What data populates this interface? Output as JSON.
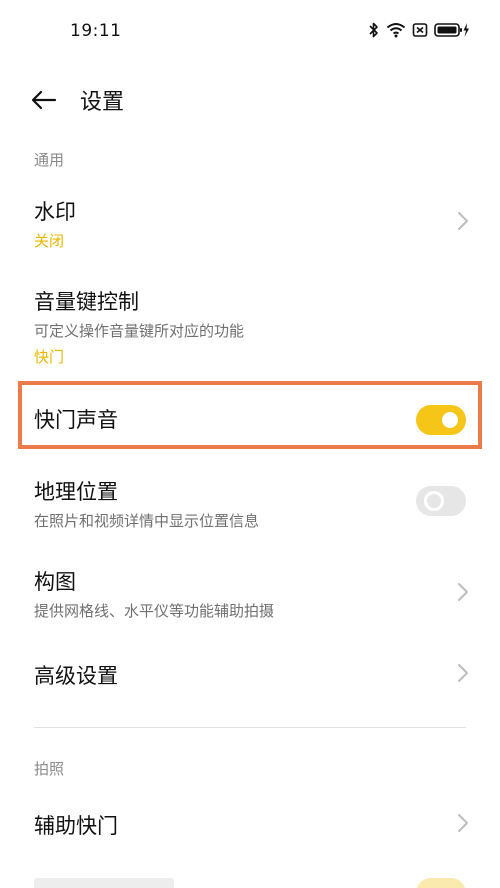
{
  "status_bar": {
    "time": "19:11",
    "icons": [
      "bluetooth-icon",
      "wifi-icon",
      "sim-off-icon",
      "battery-charging-icon"
    ]
  },
  "header": {
    "back_icon": "back-arrow-icon",
    "title": "设置"
  },
  "sections": {
    "general": "通用",
    "photo": "拍照"
  },
  "rows": {
    "watermark": {
      "title": "水印",
      "value": "关闭"
    },
    "volume_key": {
      "title": "音量键控制",
      "desc": "可定义操作音量键所对应的功能",
      "value": "快门"
    },
    "shutter_sound": {
      "title": "快门声音",
      "toggle": "on"
    },
    "location": {
      "title": "地理位置",
      "desc": "在照片和视频详情中显示位置信息",
      "toggle": "off"
    },
    "composition": {
      "title": "构图",
      "desc": "提供网格线、水平仪等功能辅助拍摄"
    },
    "advanced": {
      "title": "高级设置"
    },
    "assist_shutter": {
      "title": "辅助快门"
    }
  },
  "colors": {
    "accent": "#f5c518",
    "value_text": "#e8b700",
    "highlight": "#ec7a4b"
  }
}
